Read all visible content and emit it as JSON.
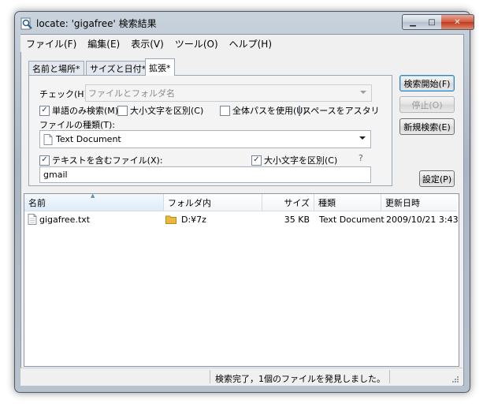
{
  "window": {
    "title": "locate: 'gigafree' 検索結果",
    "minimize_icon": "minimize-icon",
    "maximize_icon": "maximize-icon",
    "close_icon": "close-icon",
    "minimize_glyph": "▁",
    "maximize_glyph": "□",
    "close_glyph": "✕"
  },
  "menu": [
    "ファイル(F)",
    "編集(E)",
    "表示(V)",
    "ツール(O)",
    "ヘルプ(H)"
  ],
  "tabs": [
    {
      "label": "名前と場所*",
      "active": false
    },
    {
      "label": "サイズと日付*",
      "active": false
    },
    {
      "label": "拡張*",
      "active": true
    }
  ],
  "form": {
    "check_label": "チェック(H):",
    "check_value": "ファイルとフォルダ名",
    "options": [
      {
        "label": "単語のみ検索(M)",
        "checked": true
      },
      {
        "label": "大小文字を区別(C)",
        "checked": false
      },
      {
        "label": "全体パスを使用(U)",
        "checked": false
      },
      {
        "label": "スペースをアスタリス:",
        "checked": false
      }
    ],
    "filetype_label": "ファイルの種類(T):",
    "filetype_value": "Text Document",
    "containing_label": "テキストを含むファイル(X):",
    "containing_checked": true,
    "case_label": "大小文字を区別(C)",
    "case_checked": true,
    "help_mark": "?",
    "containing_value": "gmail",
    "check_glyph": "✓"
  },
  "buttons": {
    "search": "検索開始(F)",
    "stop": "停止(O)",
    "new_search": "新規検索(E)",
    "settings": "設定(P)"
  },
  "list": {
    "columns": [
      "名前",
      "フォルダ内",
      "サイズ",
      "種類",
      "更新日時"
    ],
    "sort_glyph": "▲",
    "rows": [
      {
        "name": "gigafree.txt",
        "folder": "D:¥7z",
        "size": "35 KB",
        "type": "Text Document",
        "modified": "2009/10/21 3:43"
      }
    ]
  },
  "status": {
    "text": "検索完了，1個のファイルを発見しました。"
  },
  "colors": {
    "accent": "#3c7fb1",
    "folder": "#e8b93a"
  }
}
